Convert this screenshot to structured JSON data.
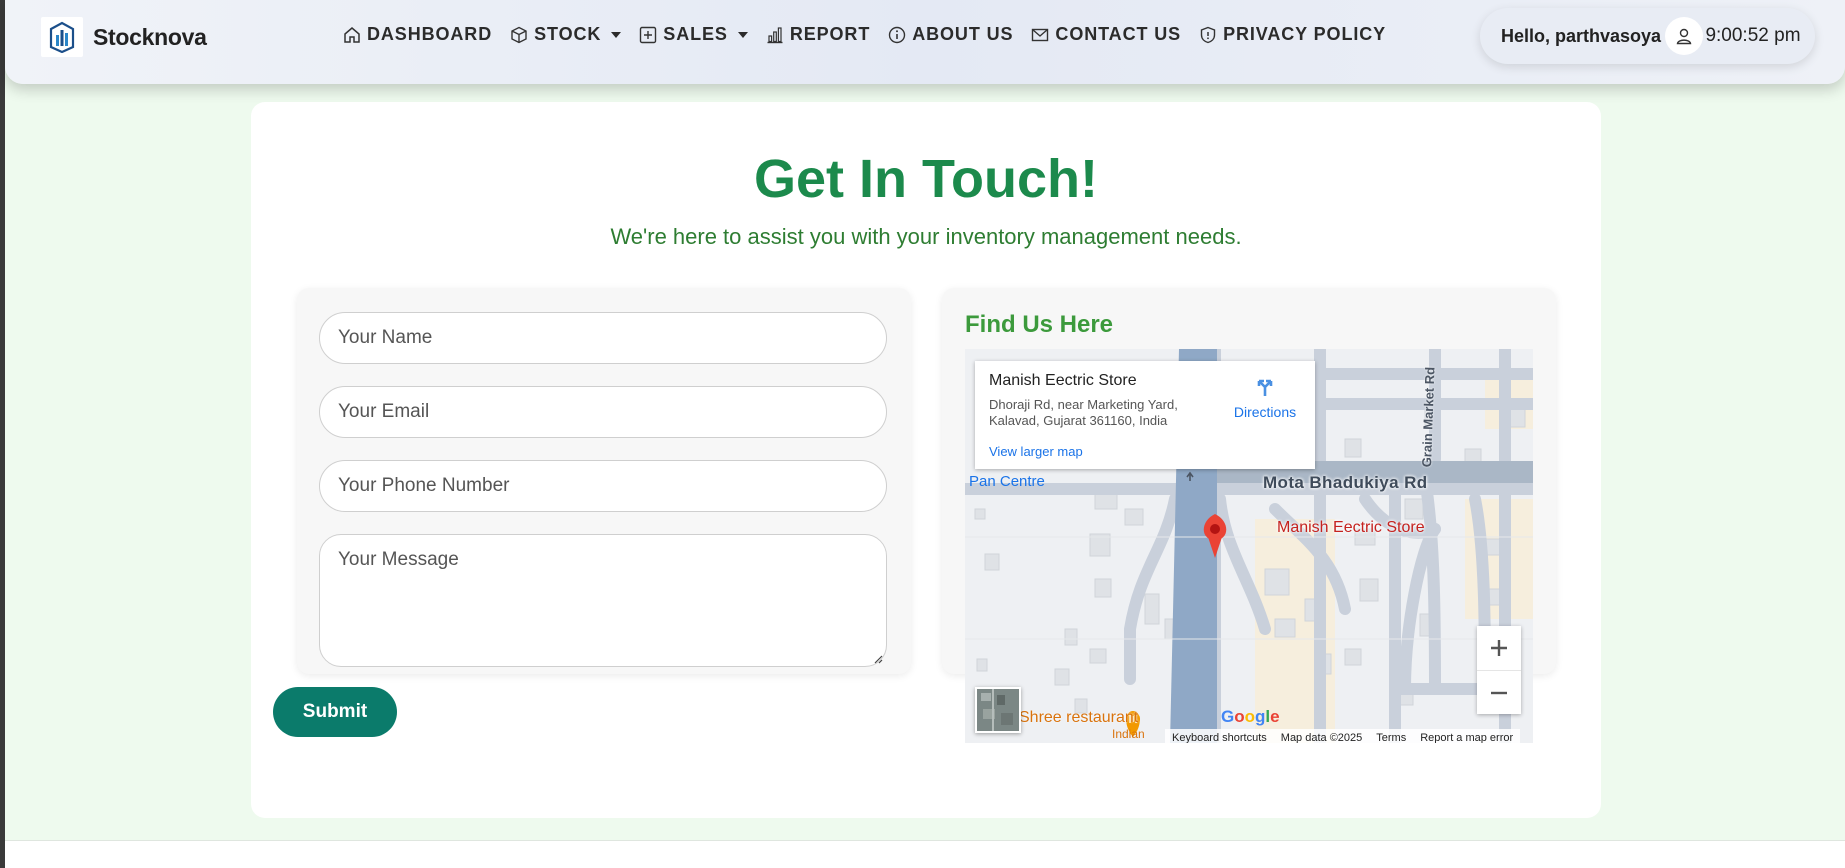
{
  "brand": {
    "name": "Stocknova"
  },
  "nav": {
    "dashboard": "DASHBOARD",
    "stock": "STOCK",
    "sales": "SALES",
    "report": "REPORT",
    "about": "ABOUT US",
    "contact": "CONTACT US",
    "privacy": "PRIVACY POLICY"
  },
  "user": {
    "greeting": "Hello, parthvasoya",
    "time": "9:00:52 pm"
  },
  "hero": {
    "title": "Get In Touch!",
    "subtitle": "We're here to assist you with your inventory management needs."
  },
  "form": {
    "name_placeholder": "Your Name",
    "email_placeholder": "Your Email",
    "phone_placeholder": "Your Phone Number",
    "message_placeholder": "Your Message",
    "submit_label": "Submit"
  },
  "map": {
    "heading": "Find Us Here",
    "place_name": "Manish Eectric Store",
    "address": "Dhoraji Rd, near Marketing Yard, Kalavad, Gujarat 361160, India",
    "directions_label": "Directions",
    "larger_map_label": "View larger map",
    "labels": {
      "pan_centre": "Pan Centre",
      "road": "Mota Bhadukiya Rd",
      "grain_market": "Grain Market Rd",
      "pin": "Manish Eectric Store",
      "restaurant": "Shree restaurant",
      "restaurant_type": "Indian"
    },
    "google_logo": "Google",
    "attribution": {
      "shortcuts": "Keyboard shortcuts",
      "data": "Map data ©2025",
      "terms": "Terms",
      "report": "Report a map error"
    }
  },
  "colors": {
    "title_green": "#1c8a4c",
    "subtitle_green": "#2e7d32",
    "submit_teal": "#0b7b6b",
    "map_heading_green": "#3c9a3c",
    "page_bg": "#eefaee"
  }
}
